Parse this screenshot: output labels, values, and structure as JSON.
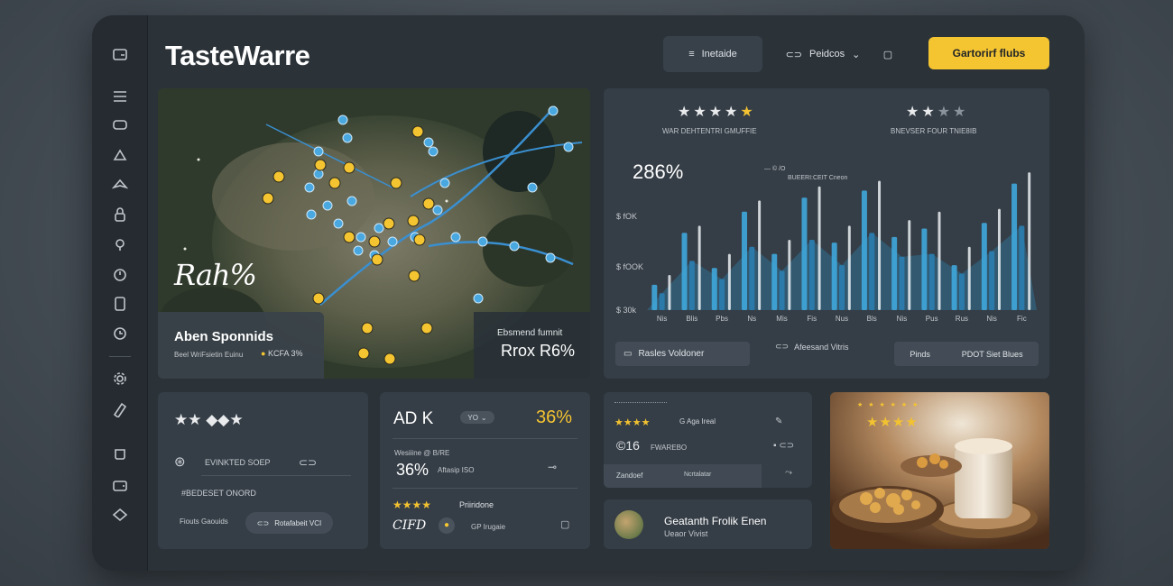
{
  "app": {
    "title": "TasteWarre"
  },
  "toolbar": {
    "btn1_label": "Inetaide",
    "btn2_label": "Peidcos",
    "cta_label": "Gartorirf flubs"
  },
  "map": {
    "script_label": "Rah%",
    "info_title": "Aben Sponnids",
    "info_sub1": "Beel WriFsietin Euinu",
    "info_sub2": "KCFA 3%",
    "stat_title": "Ebsmend fumnit",
    "stat_value": "Rrox R6%"
  },
  "chart": {
    "stars_left_label": "WAR DEHTENTRI GMUFFIE",
    "stars_right_label": "BNEVSER FOUR TNIE8IB",
    "stars_left_rating": 4.5,
    "stars_right_rating": 2,
    "big_value": "286%",
    "legend1": "— © /O",
    "legend2": "BUEERI:CEIT Cneon",
    "btn_left": "Rasles Voldoner",
    "middle_label": "Afeesand Vitris",
    "btn_right1": "Pinds",
    "btn_right2": "PDOT Siet Blues"
  },
  "chart_data": {
    "type": "bar",
    "categories": [
      "Nis",
      "Blis",
      "Pbs",
      "Ns",
      "Mis",
      "Fis",
      "Nus",
      "Bls",
      "Nis",
      "Pus",
      "Rus",
      "Nis",
      "Fic"
    ],
    "ytick_labels": [
      "$ 30k",
      "$ fOOK",
      "$ fOK"
    ],
    "series": [
      {
        "values": [
          18,
          55,
          30,
          70,
          40,
          80,
          48,
          85,
          52,
          58,
          32,
          62,
          90
        ]
      },
      {
        "values": [
          12,
          35,
          22,
          45,
          28,
          50,
          32,
          55,
          38,
          40,
          26,
          42,
          60
        ]
      },
      {
        "values": [
          25,
          60,
          40,
          78,
          50,
          88,
          60,
          92,
          64,
          70,
          45,
          72,
          98
        ]
      }
    ],
    "ylim": [
      0,
      100
    ]
  },
  "card1": {
    "label1": "EVINKTED SOEP",
    "label2": "#BEDESET ONORD",
    "label3": "Fiouts Gaouids",
    "btn": "Rotafabeit VCI"
  },
  "card2": {
    "title": "AD K",
    "dropdown": "YO",
    "percent": "36%",
    "sub_small": "Wesiiine @ B/RE",
    "value": "36%",
    "value_note": "Aftasip ISO",
    "rating_label": "Priiridone",
    "foot_left": "CIFD",
    "foot_mid": "GP Irugaie"
  },
  "card3": {
    "row1_label": "G Aga Ireal",
    "row2_value": "©16",
    "row2_label": "FWAREBO",
    "row3_label1": "Zandoef",
    "row3_label2": "Ncrtalatar"
  },
  "card4": {
    "name": "Geatanth Frolik Enen",
    "sub": "Ueaor Vivist"
  },
  "colors": {
    "accent": "#f4c431",
    "panel": "#353d46",
    "bar_blue": "#4aa8e0"
  }
}
